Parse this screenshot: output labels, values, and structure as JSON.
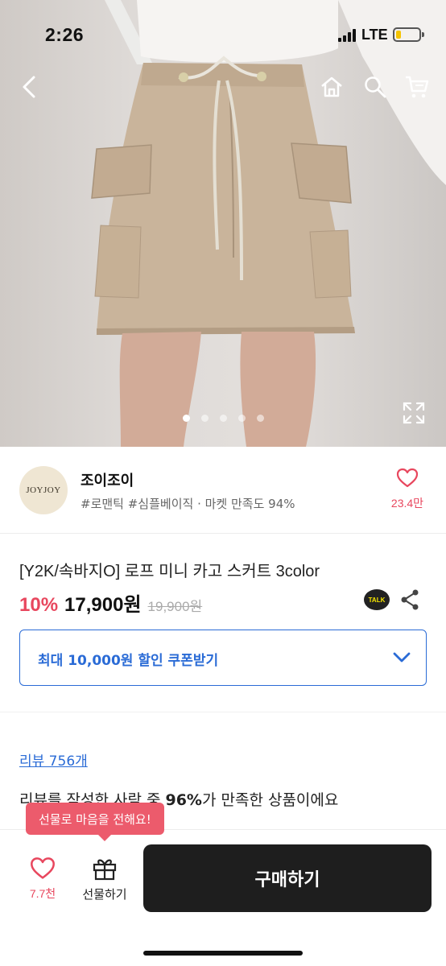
{
  "status_bar": {
    "time": "2:26",
    "network": "LTE"
  },
  "nav": {
    "back_icon": "chevron-left-icon",
    "home_icon": "home-icon",
    "search_icon": "search-icon",
    "cart_icon": "cart-icon"
  },
  "gallery": {
    "image_count": 5,
    "active_index": 0,
    "expand_icon": "expand-icon"
  },
  "store": {
    "logo_text": "JOYJOY",
    "name": "조이조이",
    "tags": "#로맨틱 #심플베이직 · 마켓 만족도 94%",
    "like_count": "23.4만",
    "accent_color": "#e8475e"
  },
  "product": {
    "title": "[Y2K/속바지O] 로프 미니 카고 스커트 3color",
    "discount": "10%",
    "price": "17,900원",
    "original_price": "19,900원",
    "talk_label": "TALK"
  },
  "coupon": {
    "label": "최대 10,000원 할인 쿠폰받기",
    "color": "#2a6bd6"
  },
  "reviews": {
    "link": "리뷰 756개",
    "summary_prefix": "리뷰를 작성한 사람 중 ",
    "summary_percent": "96%",
    "summary_suffix": "가 만족한 상품이에요"
  },
  "bottom_bar": {
    "tooltip": "선물로 마음을 전해요!",
    "favorite_count": "7.7천",
    "gift_label": "선물하기",
    "buy_label": "구매하기"
  }
}
